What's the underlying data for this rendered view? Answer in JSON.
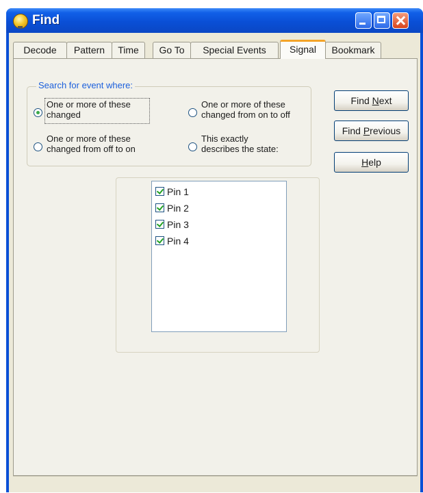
{
  "window": {
    "title": "Find"
  },
  "tabs": [
    {
      "label": "Decode"
    },
    {
      "label": "Pattern"
    },
    {
      "label": "Time"
    },
    {
      "label": "Go To"
    },
    {
      "label": "Special Events"
    },
    {
      "label": "Signal"
    },
    {
      "label": "Bookmark"
    }
  ],
  "active_tab": "Signal",
  "search": {
    "legend": "Search for event where:",
    "options": [
      {
        "line1": "One or more of these",
        "line2": "changed",
        "checked": true
      },
      {
        "line1": "One or more of these",
        "line2": "changed from on to off",
        "checked": false
      },
      {
        "line1": "One or more of these",
        "line2": "changed from off to on",
        "checked": false
      },
      {
        "line1": "This exactly",
        "line2": "describes the state:",
        "checked": false
      }
    ]
  },
  "buttons": {
    "find_next": {
      "pre": "Find ",
      "accel": "N",
      "post": "ext"
    },
    "find_previous": {
      "pre": "Find ",
      "accel": "P",
      "post": "revious"
    },
    "help": {
      "pre": "",
      "accel": "H",
      "post": "elp"
    }
  },
  "pins": [
    {
      "label": "Pin 1",
      "checked": true
    },
    {
      "label": "Pin 2",
      "checked": true
    },
    {
      "label": "Pin 3",
      "checked": true
    },
    {
      "label": "Pin 4",
      "checked": true
    }
  ],
  "colors": {
    "titlebar": "#0a4fd6",
    "legend_text": "#1b5fdc",
    "active_tab_highlight": "#f4a428",
    "check_green": "#21a121"
  }
}
